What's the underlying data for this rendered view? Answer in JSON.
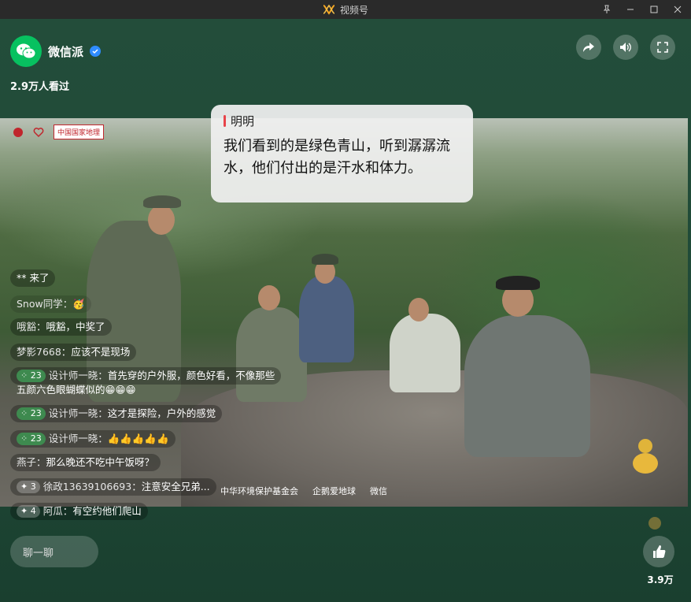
{
  "window": {
    "title": "视频号"
  },
  "channel": {
    "name": "微信派",
    "views": "2.9万人看过"
  },
  "caption": {
    "speaker": "明明",
    "text": "我们看到的是绿色青山，听到潺潺流水，他们付出的是汗水和体力。"
  },
  "sponsors": {
    "top": [
      "中国国家地理"
    ],
    "bottom": [
      "中华环境保护基金会",
      "企鹅爱地球",
      "微信"
    ]
  },
  "comments": [
    {
      "badge": "",
      "name": "",
      "text": "** 来了"
    },
    {
      "badge": "",
      "name": "Snow同学：",
      "text": "🥳"
    },
    {
      "badge": "",
      "name": "哦豁：",
      "text": "哦豁，中奖了"
    },
    {
      "badge": "",
      "name": "梦影7668：",
      "text": "应该不是现场"
    },
    {
      "badge": "23",
      "name": "设计师一晓：",
      "text": "首先穿的户外服，颜色好看，不像那些"
    },
    {
      "badge": "",
      "name": "",
      "text": "五颜六色眼蝴蝶似的😁😁😁"
    },
    {
      "badge": "23",
      "name": "设计师一晓：",
      "text": "这才是探险，户外的感觉"
    },
    {
      "badge": "23",
      "name": "设计师一晓：",
      "text": "👍👍👍👍👍"
    },
    {
      "badge": "",
      "name": "燕子：",
      "text": "那么晚还不吃中午饭呀？"
    },
    {
      "badge": "3",
      "name": "徐政13639106693：",
      "text": "注意安全兄弟..."
    },
    {
      "badge": "4",
      "name": "阿瓜：",
      "text": "有空约他们爬山"
    }
  ],
  "chat": {
    "placeholder": "聊一聊"
  },
  "likes": {
    "count": "3.9万"
  },
  "colors": {
    "accent": "#07c160",
    "background": "#1f4a37",
    "caption_bar": "#e8444a"
  }
}
